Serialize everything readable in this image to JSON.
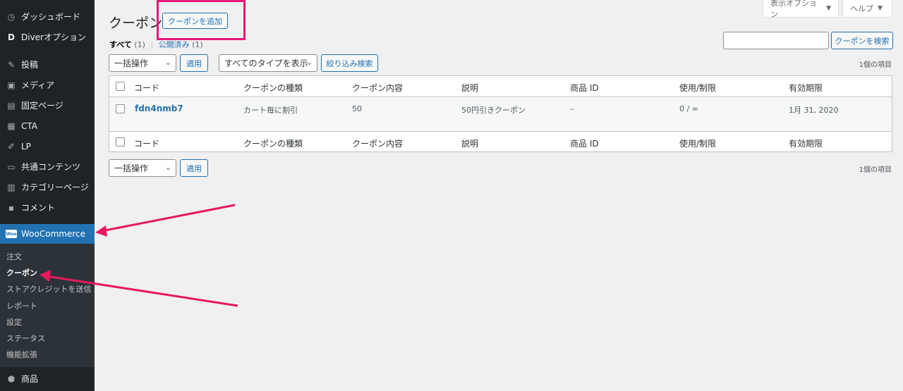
{
  "sidebar": {
    "items": [
      {
        "icon": "dashboard-icon",
        "glyph": "◷",
        "label": "ダッシュボード"
      },
      {
        "icon": "diver-logo-icon",
        "glyph": "D",
        "label": "Diverオプション"
      },
      {
        "icon": "pin-icon",
        "glyph": "✎",
        "label": "投稿"
      },
      {
        "icon": "media-icon",
        "glyph": "▣",
        "label": "メディア"
      },
      {
        "icon": "page-icon",
        "glyph": "▤",
        "label": "固定ページ"
      },
      {
        "icon": "cta-icon",
        "glyph": "▦",
        "label": "CTA"
      },
      {
        "icon": "lp-icon",
        "glyph": "✐",
        "label": "LP"
      },
      {
        "icon": "folder-icon",
        "glyph": "▭",
        "label": "共通コンテンツ"
      },
      {
        "icon": "category-page-icon",
        "glyph": "▥",
        "label": "カテゴリーページ"
      },
      {
        "icon": "comment-icon",
        "glyph": "▪",
        "label": "コメント"
      }
    ],
    "woocommerce": {
      "badge": "Woo",
      "label": "WooCommerce"
    },
    "submenu": [
      "注文",
      "クーポン",
      "ストアクレジットを送信",
      "レポート",
      "設定",
      "ステータス",
      "機能拡張"
    ],
    "submenu_current_index": 1,
    "product": {
      "icon": "product-box-icon",
      "glyph": "⬢",
      "label": "商品"
    }
  },
  "header": {
    "screen_options": "表示オプション",
    "help": "ヘルプ",
    "page_title": "クーポン",
    "add_button": "クーポンを追加"
  },
  "filters": {
    "all_label": "すべて",
    "all_count": "(1)",
    "published_label": "公開済み",
    "published_count": "(1)",
    "search_button": "クーポンを検索",
    "search_value": "",
    "bulk_action": "一括操作",
    "apply": "適用",
    "type_filter": "すべてのタイプを表示",
    "filter_button": "絞り込み検索",
    "items_count": "1個の項目"
  },
  "table": {
    "columns": [
      "コード",
      "クーポンの種類",
      "クーポン内容",
      "説明",
      "商品 ID",
      "使用/制限",
      "有効期限"
    ],
    "rows": [
      {
        "code": "fdn4nmb7",
        "type": "カート毎に割引",
        "amount": "50",
        "description": "50円引きクーポン",
        "product_ids": "–",
        "usage": "0 / ∞",
        "expiry": "1月 31, 2020"
      }
    ]
  },
  "annotations": {
    "highlight_color": "#e6197a",
    "arrow_color": "#e6195a"
  }
}
